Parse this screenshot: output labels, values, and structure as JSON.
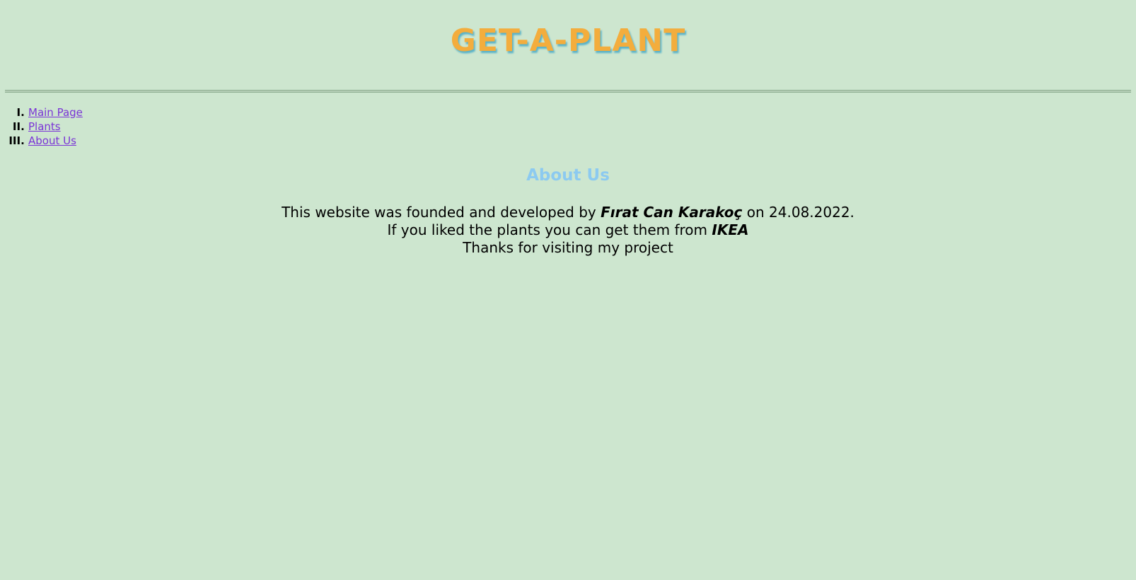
{
  "header": {
    "title": "GET-A-PLANT"
  },
  "nav": {
    "items": [
      {
        "label": "Main Page"
      },
      {
        "label": "Plants"
      },
      {
        "label": "About Us"
      }
    ]
  },
  "about": {
    "heading": "About Us",
    "line1_prefix": "This website was founded and developed by ",
    "founder_name": "Fırat Can Karakoç",
    "line1_suffix": " on 24.08.2022.",
    "line2_prefix": "If you liked the plants you can get them from ",
    "store_name": "IKEA",
    "line3": "Thanks for visiting my project"
  },
  "colors": {
    "background": "#cde6cf",
    "title": "#f3ad3d",
    "title_shadow": "#5ab3c9",
    "heading": "#8ccaf0",
    "link": "#7a34d6"
  }
}
